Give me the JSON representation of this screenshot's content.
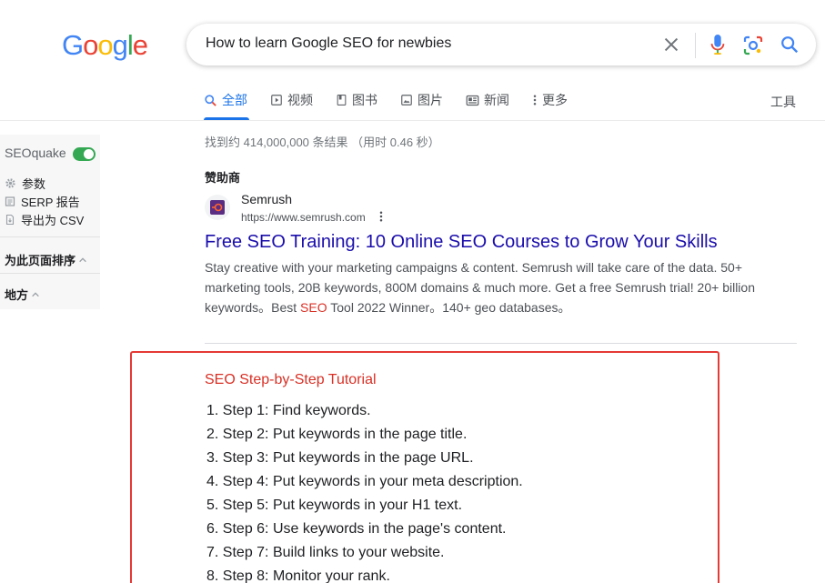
{
  "logo": {
    "text": "Google",
    "letters": [
      "G",
      "o",
      "o",
      "g",
      "l",
      "e"
    ]
  },
  "search": {
    "query": "How to learn Google SEO for newbies"
  },
  "tabs": [
    {
      "label": "全部",
      "icon": "search-icon",
      "active": true
    },
    {
      "label": "视频",
      "icon": "video-icon",
      "active": false
    },
    {
      "label": "图书",
      "icon": "book-icon",
      "active": false
    },
    {
      "label": "图片",
      "icon": "image-icon",
      "active": false
    },
    {
      "label": "新闻",
      "icon": "news-icon",
      "active": false
    },
    {
      "label": "更多",
      "icon": "more-vert-icon",
      "active": false
    }
  ],
  "tools_label": "工具",
  "seoquake": {
    "title": "SEOquake",
    "enabled": true,
    "items": [
      {
        "label": "参数",
        "icon": "gear-icon"
      },
      {
        "label": "SERP 报告",
        "icon": "report-icon"
      },
      {
        "label": "导出为 CSV",
        "icon": "export-icon"
      }
    ],
    "sections": [
      "为此页面排序",
      "地方"
    ]
  },
  "stats": "找到约 414,000,000 条结果 （用时 0.46 秒）",
  "ad": {
    "sponsor_label": "赞助商",
    "site_name": "Semrush",
    "url": "https://www.semrush.com",
    "title": "Free SEO Training: 10 Online SEO Courses to Grow Your Skills",
    "desc_before": "Stay creative with your marketing campaigns & content. Semrush will take care of the data. 50+ marketing tools, 20B keywords, 800M domains & much more. Get a free Semrush trial! 20+ billion keywords。Best ",
    "desc_highlight": "SEO",
    "desc_after": " Tool 2022 Winner。140+ geo databases。"
  },
  "snippet": {
    "title": "SEO Step-by-Step Tutorial",
    "steps": [
      "Step 1: Find keywords.",
      "Step 2: Put keywords in the page title.",
      "Step 3: Put keywords in the page URL.",
      "Step 4: Put keywords in your meta description.",
      "Step 5: Put keywords in your H1 text.",
      "Step 6: Use keywords in the page's content.",
      "Step 7: Build links to your website.",
      "Step 8: Monitor your rank."
    ]
  },
  "colors": {
    "link": "#1a0dab",
    "accent": "#1a73e8",
    "highlight": "#d93025",
    "toggle_on": "#34a853",
    "box_border": "#e53935"
  }
}
